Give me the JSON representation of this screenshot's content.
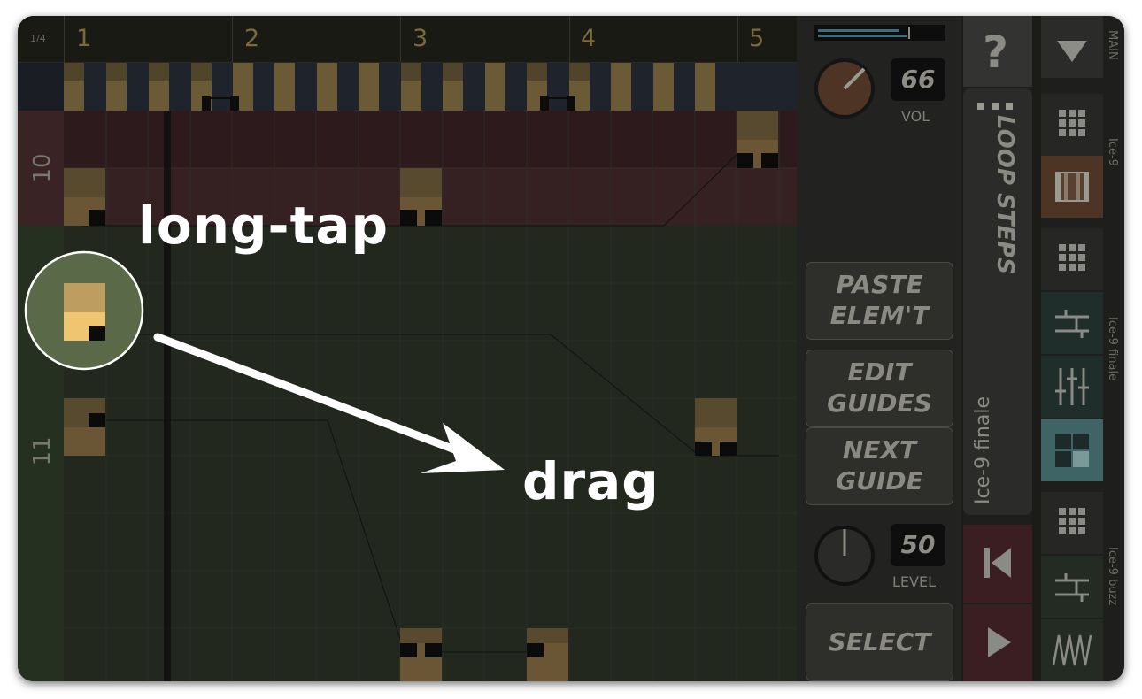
{
  "ruler": {
    "signature": "1/4",
    "bars": [
      "1",
      "2",
      "3",
      "4",
      "5"
    ]
  },
  "song_rows": [
    {
      "label": "10"
    },
    {
      "label": "11"
    }
  ],
  "annotations": {
    "tap_label": "long-tap",
    "drag_label": "drag"
  },
  "vol": {
    "value": "66",
    "label": "VOL"
  },
  "level": {
    "value": "50",
    "label": "LEVEL"
  },
  "buttons": {
    "help": "?",
    "loop_steps": "LOOP STEPS",
    "paste_line1": "PASTE",
    "paste_line2": "ELEM'T",
    "edit_line1": "EDIT",
    "edit_line2": "GUIDES",
    "next_line1": "NEXT",
    "next_line2": "GUIDE",
    "select": "SELECT",
    "pattern_name": "Ice-9 finale"
  },
  "tracks": {
    "main": "MAIN",
    "track1": "Ice-9",
    "track2": "Ice-9 finale",
    "track3": "Ice-9 buzz"
  },
  "colors": {
    "accent_gold": "#6e5a34",
    "selected_gold": "#f0c572",
    "row_red": "#2d1a1c",
    "row_green": "#22281d"
  }
}
